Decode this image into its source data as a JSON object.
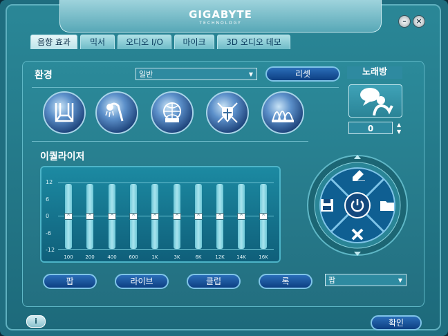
{
  "window": {
    "brand": "GIGABYTE",
    "brand_sub": "TECHNOLOGY",
    "minimize_label": "–",
    "close_label": "×"
  },
  "tabs": [
    {
      "label": "음향 효과",
      "active": true
    },
    {
      "label": "믹서",
      "active": false
    },
    {
      "label": "오디오 I/O",
      "active": false
    },
    {
      "label": "마이크",
      "active": false
    },
    {
      "label": "3D 오디오 데모",
      "active": false
    }
  ],
  "environment": {
    "label": "환경",
    "selected": "일반",
    "reset_label": "리셋",
    "icons": [
      "room-icon",
      "shower-icon",
      "globe-icon",
      "knight-helmet-icon",
      "opera-house-icon"
    ]
  },
  "karaoke": {
    "title": "노래방",
    "value": "0",
    "icon": "speech-bubble-person-icon"
  },
  "equalizer": {
    "label": "이퀄라이저",
    "db_labels": [
      "12",
      "6",
      "0",
      "-6",
      "-12"
    ],
    "bands": [
      {
        "freq": "100",
        "level": 0
      },
      {
        "freq": "200",
        "level": 0
      },
      {
        "freq": "400",
        "level": 0
      },
      {
        "freq": "600",
        "level": 0
      },
      {
        "freq": "1K",
        "level": 0
      },
      {
        "freq": "3K",
        "level": 0
      },
      {
        "freq": "6K",
        "level": 0
      },
      {
        "freq": "12K",
        "level": 0
      },
      {
        "freq": "14K",
        "level": 0
      },
      {
        "freq": "16K",
        "level": 0
      }
    ],
    "presets": [
      "팝",
      "라이브",
      "클럽",
      "록"
    ],
    "preset_selected": "팝"
  },
  "controls": {
    "icons": [
      "eraser-icon",
      "save-icon",
      "power-icon",
      "folder-icon",
      "delete-icon"
    ]
  },
  "footer": {
    "info_label": "i",
    "ok_label": "확인"
  }
}
